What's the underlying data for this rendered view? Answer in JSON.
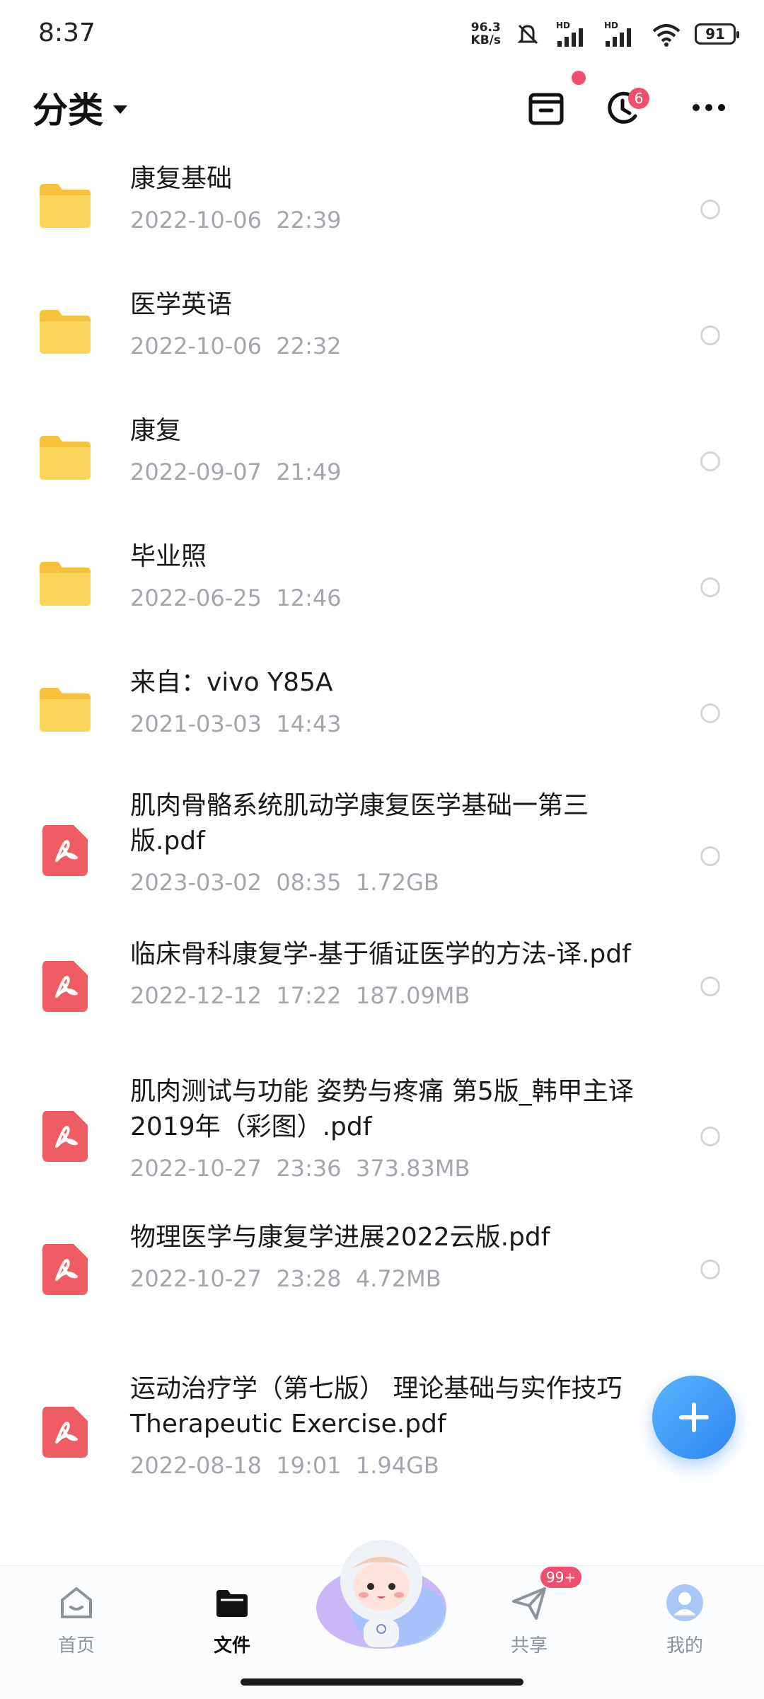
{
  "status_bar": {
    "time": "8:37",
    "net_speed_value": "96.3",
    "net_speed_unit": "KB/s",
    "battery": "91",
    "signal_label_1": "HD",
    "signal_label_2": "HD"
  },
  "header": {
    "title": "分类",
    "notification_count": "6"
  },
  "files": [
    {
      "name": "康复基础",
      "date": "2022-10-06",
      "time": "22:39",
      "type": "folder"
    },
    {
      "name": "医学英语",
      "date": "2022-10-06",
      "time": "22:32",
      "type": "folder"
    },
    {
      "name": "康复",
      "date": "2022-09-07",
      "time": "21:49",
      "type": "folder"
    },
    {
      "name": "毕业照",
      "date": "2022-06-25",
      "time": "12:46",
      "type": "folder"
    },
    {
      "name": "来自：vivo Y85A",
      "date": "2021-03-03",
      "time": "14:43",
      "type": "folder"
    },
    {
      "name": "肌肉骨骼系统肌动学康复医学基础一第三版.pdf",
      "date": "2023-03-02",
      "time": "08:35",
      "size": "1.72GB",
      "type": "pdf"
    },
    {
      "name": "临床骨科康复学-基于循证医学的方法-译.pdf",
      "date": "2022-12-12",
      "time": "17:22",
      "size": "187.09MB",
      "type": "pdf"
    },
    {
      "name": "肌肉测试与功能 姿势与疼痛 第5版_韩甲主译2019年（彩图）.pdf",
      "date": "2022-10-27",
      "time": "23:36",
      "size": "373.83MB",
      "type": "pdf"
    },
    {
      "name": "物理医学与康复学进展2022云版.pdf",
      "date": "2022-10-27",
      "time": "23:28",
      "size": "4.72MB",
      "type": "pdf"
    },
    {
      "name": "运动治疗学（第七版） 理论基础与实作技巧Therapeutic Exercise.pdf",
      "date": "2022-08-18",
      "time": "19:01",
      "size": "1.94GB",
      "type": "pdf"
    }
  ],
  "bottom_nav": {
    "home": "首页",
    "files": "文件",
    "share": "共享",
    "share_badge": "99+",
    "mine": "我的"
  },
  "colors": {
    "accent_blue": "#2c86f0",
    "badge_red": "#f0506e",
    "folder_yellow": "#f9cf4a",
    "pdf_red": "#ee5d63",
    "meta_gray": "#a3a6ad"
  },
  "icons": {
    "header": [
      "archive-icon",
      "clock-sync-icon",
      "more-icon"
    ],
    "nav": [
      "home-icon",
      "folder-icon",
      "send-icon",
      "avatar-icon"
    ]
  }
}
